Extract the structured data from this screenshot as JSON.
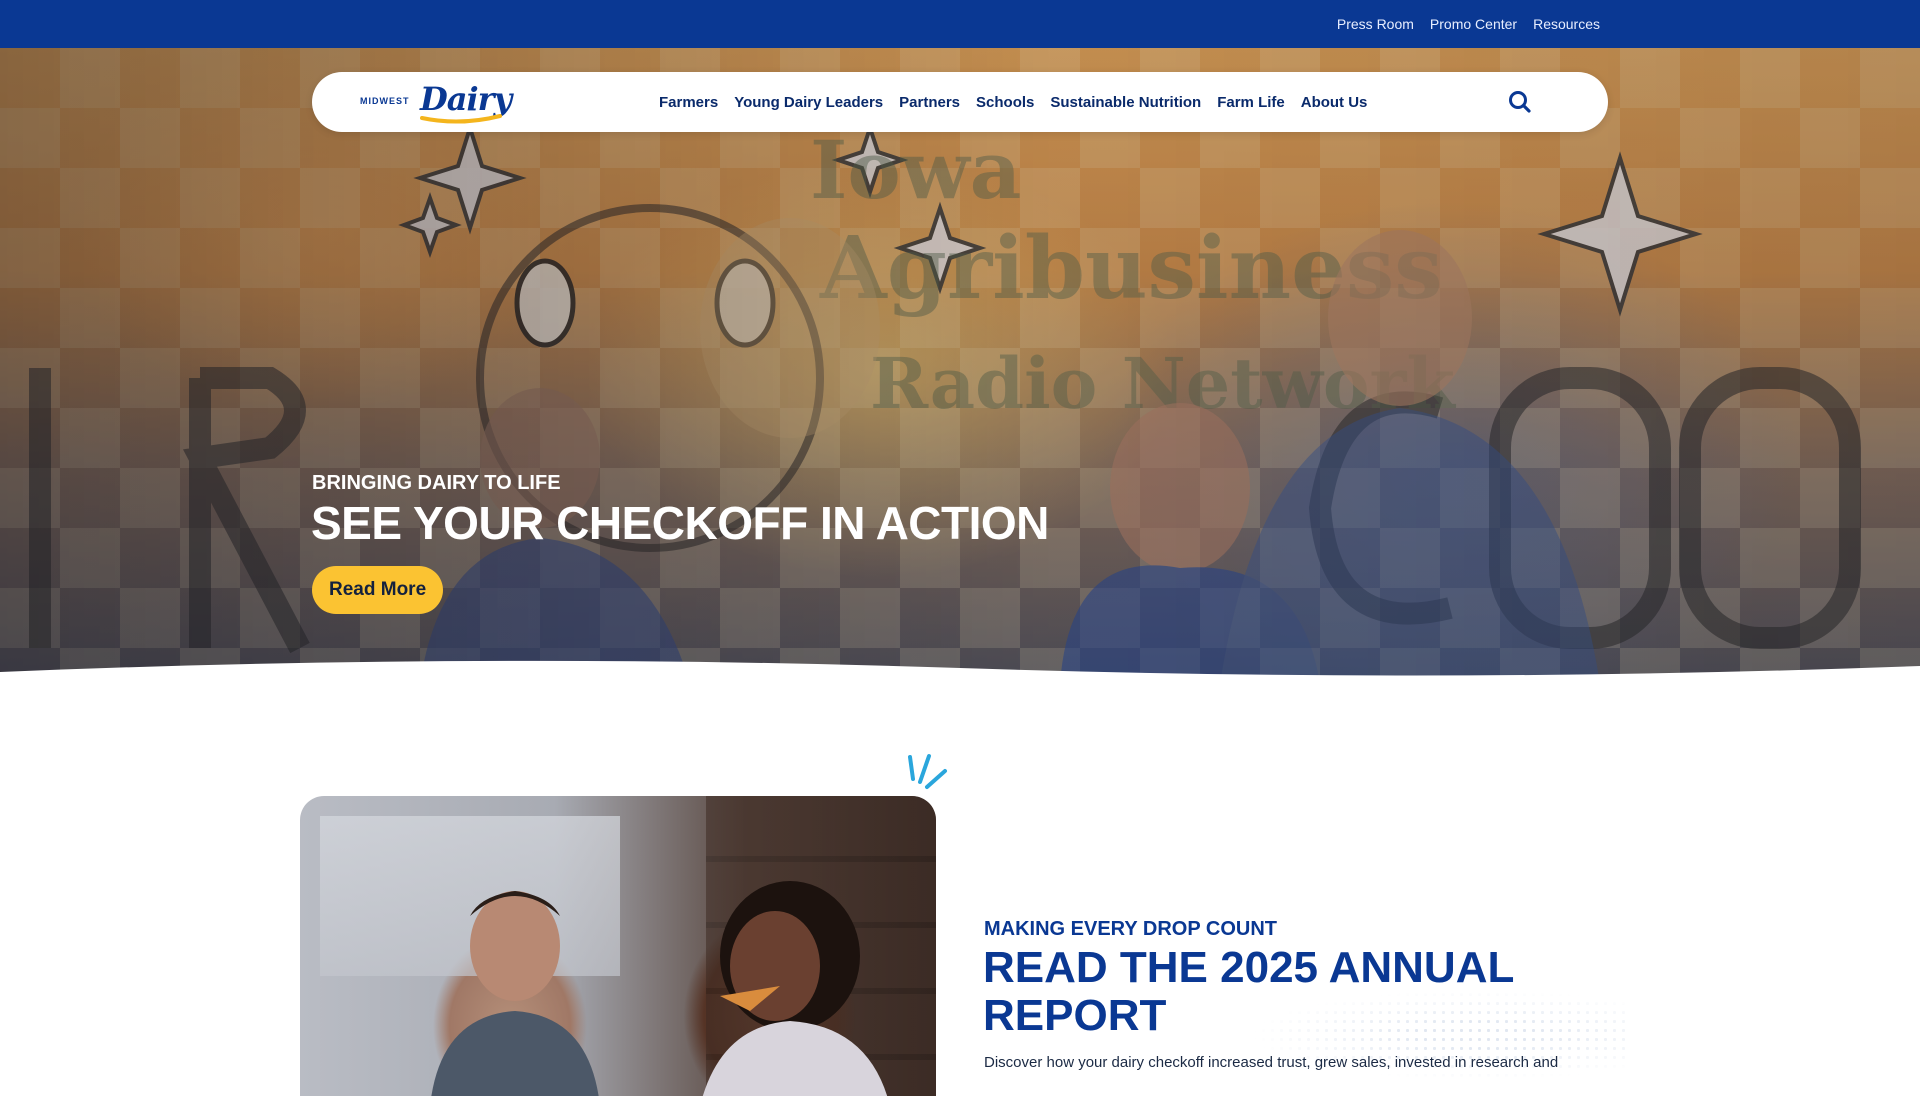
{
  "utility_nav": {
    "links": [
      "Press Room",
      "Promo Center",
      "Resources"
    ]
  },
  "logo": {
    "small_text": "MIDWEST",
    "script_text": "Dairy"
  },
  "main_nav": {
    "items": [
      "Farmers",
      "Young Dairy Leaders",
      "Partners",
      "Schools",
      "Sustainable Nutrition",
      "Farm Life",
      "About Us"
    ],
    "search_icon": "search-icon"
  },
  "hero": {
    "eyebrow": "BRINGING DAIRY TO LIFE",
    "title": "SEE YOUR CHECKOFF IN ACTION",
    "button_label": "Read More"
  },
  "report": {
    "eyebrow": "MAKING EVERY DROP COUNT",
    "title": "READ THE 2025 ANNUAL REPORT",
    "description": "Discover how your dairy checkoff increased trust, grew sales, invested in research and"
  },
  "colors": {
    "brand_blue": "#0a3893",
    "accent_yellow": "#fbc332",
    "burst_blue": "#2aa6dc"
  }
}
